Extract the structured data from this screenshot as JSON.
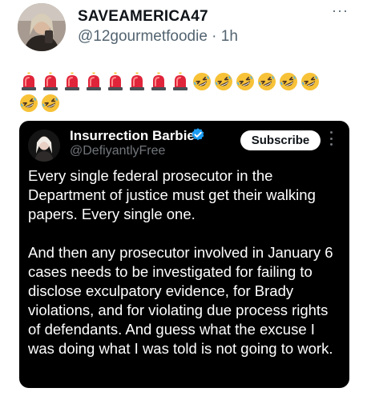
{
  "post": {
    "author_name": "SAVEAMERICA47",
    "author_handle": "@12gourmetfoodie",
    "separator": "·",
    "timestamp": "1h",
    "more_label": "···",
    "emoji_row_1": [
      "police-light",
      "police-light",
      "police-light",
      "police-light",
      "police-light",
      "police-light",
      "police-light",
      "police-light",
      "rofl",
      "rofl",
      "rofl",
      "rofl",
      "rofl",
      "rofl"
    ],
    "emoji_row_2": [
      "rofl",
      "rofl"
    ]
  },
  "quote": {
    "author_name": "Insurrection Barbie",
    "author_handle": "@DefiyantlyFree",
    "verified": true,
    "subscribe_label": "Subscribe",
    "paragraphs": [
      "Every single federal prosecutor in the Department of justice must get their walking papers. Every single one.",
      "And then any prosecutor involved in January 6 cases needs to be investigated for failing to disclose exculpatory evidence, for Brady violations, and for violating due process rights of defendants. And guess what the excuse I was doing what I was told is not going to work."
    ]
  },
  "colors": {
    "background": "#ffffff",
    "text_primary": "#0f1419",
    "text_secondary": "#536471",
    "quote_background": "#000000",
    "verified_blue": "#1d9bf0",
    "police_light_red": "#e0243a",
    "emoji_yellow": "#f7c238"
  }
}
